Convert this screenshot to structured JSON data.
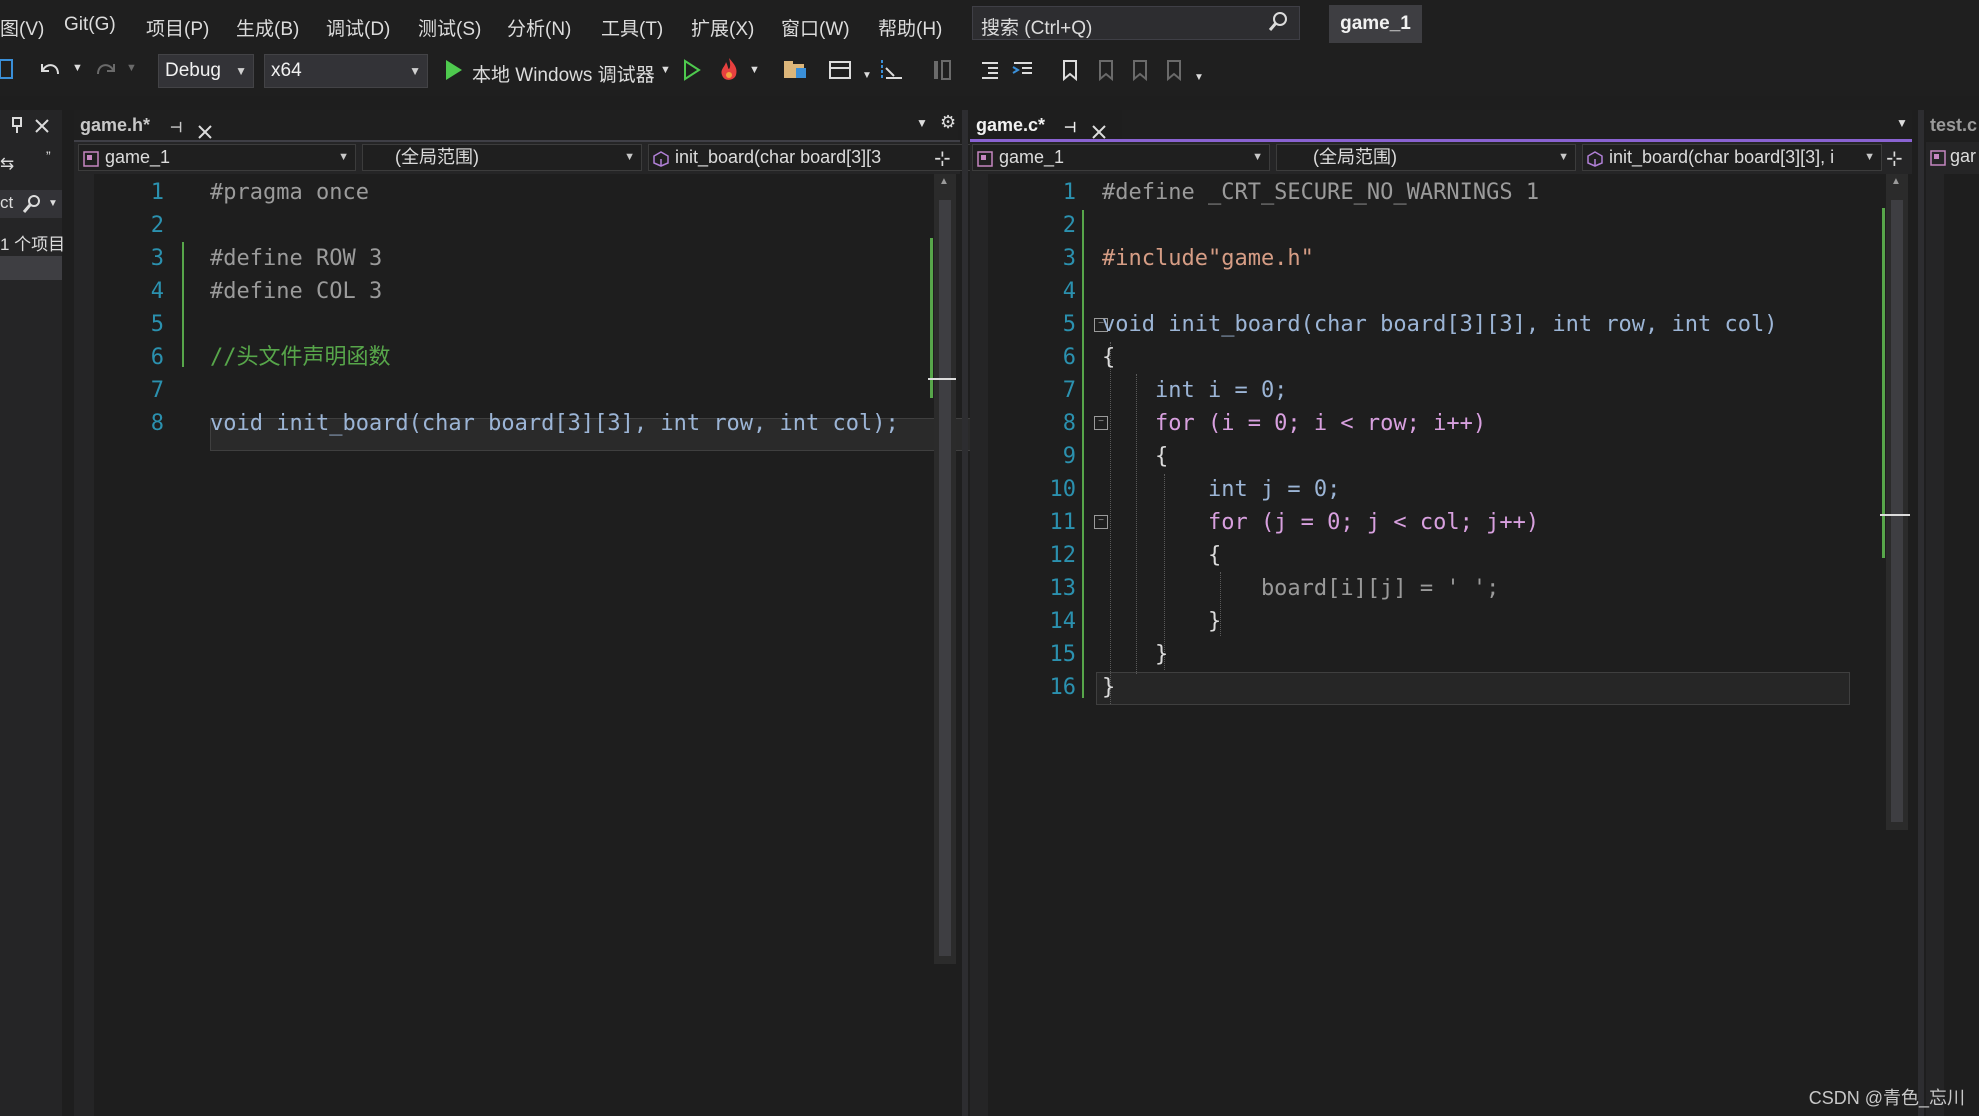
{
  "menu": {
    "items": [
      "图(V)",
      "Git(G)",
      "项目(P)",
      "生成(B)",
      "调试(D)",
      "测试(S)",
      "分析(N)",
      "工具(T)",
      "扩展(X)",
      "窗口(W)",
      "帮助(H)"
    ],
    "search_placeholder": "搜索 (Ctrl+Q)",
    "solution_name": "game_1"
  },
  "toolbar": {
    "config": "Debug",
    "platform": "x64",
    "run_label": "本地 Windows 调试器"
  },
  "left_panel": {
    "search_stub": "ct",
    "items_stub": "1 个项目"
  },
  "left_pane": {
    "tab_label": "game.h*",
    "nav_project": "game_1",
    "nav_scope": "(全局范围)",
    "nav_member": "init_board(char board[3][3"
  },
  "right_pane": {
    "tab_label": "game.c*",
    "nav_project": "game_1",
    "nav_scope": "(全局范围)",
    "nav_member": "init_board(char board[3][3], i"
  },
  "far_right": {
    "tab_label": "test.c",
    "nav_project": "gar"
  },
  "header_code": {
    "line_numbers": [
      "1",
      "2",
      "3",
      "4",
      "5",
      "6",
      "7",
      "8"
    ],
    "lines": [
      "#pragma once",
      "",
      "#define ROW 3",
      "#define COL 3",
      "",
      "//头文件声明函数",
      "",
      "void init_board(char board[3][3], int row, int col);"
    ]
  },
  "source_code": {
    "line_numbers": [
      "1",
      "2",
      "3",
      "4",
      "5",
      "6",
      "7",
      "8",
      "9",
      "10",
      "11",
      "12",
      "13",
      "14",
      "15",
      "16"
    ],
    "lines": [
      "#define _CRT_SECURE_NO_WARNINGS 1",
      "",
      "#include\"game.h\"",
      "",
      "void init_board(char board[3][3], int row, int col)",
      "{",
      "    int i = 0;",
      "    for (i = 0; i < row; i++)",
      "    {",
      "        int j = 0;",
      "        for (j = 0; j < col; j++)",
      "        {",
      "            board[i][j] = ' ';",
      "        }",
      "    }",
      "}"
    ]
  },
  "watermark": "CSDN @青色_忘川",
  "colors": {
    "accent": "#8a63d2",
    "keyword": "#569cd6",
    "control": "#d8a0df",
    "line_number": "#2b91af",
    "comment": "#57a64a"
  }
}
